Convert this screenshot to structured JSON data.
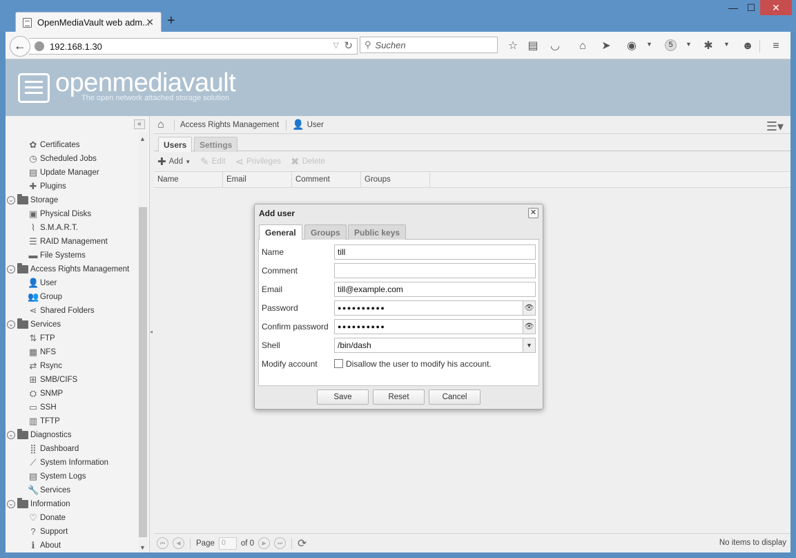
{
  "browser": {
    "tab_title": "OpenMediaVault web adm...",
    "tab_close": "✕",
    "new_tab": "+",
    "win_min": "—",
    "win_max": "☐",
    "win_close": "✕",
    "url": "192.168.1.30",
    "search_placeholder": "Suchen",
    "badge": "5"
  },
  "omv": {
    "logo_text": "openmediavault",
    "logo_sub": "The open network attached storage solution"
  },
  "sidebar": {
    "items": [
      {
        "type": "leaf",
        "label": "Certificates",
        "icon": "certificate-icon",
        "glyph": "✿"
      },
      {
        "type": "leaf",
        "label": "Scheduled Jobs",
        "icon": "clock-icon",
        "glyph": "◷"
      },
      {
        "type": "leaf",
        "label": "Update Manager",
        "icon": "update-icon",
        "glyph": "▤"
      },
      {
        "type": "leaf",
        "label": "Plugins",
        "icon": "puzzle-icon",
        "glyph": "✚"
      },
      {
        "type": "group",
        "label": "Storage"
      },
      {
        "type": "leaf",
        "label": "Physical Disks",
        "icon": "disk-icon",
        "glyph": "▣"
      },
      {
        "type": "leaf",
        "label": "S.M.A.R.T.",
        "icon": "smart-icon",
        "glyph": "⌇"
      },
      {
        "type": "leaf",
        "label": "RAID Management",
        "icon": "raid-icon",
        "glyph": "☰"
      },
      {
        "type": "leaf",
        "label": "File Systems",
        "icon": "filesystem-icon",
        "glyph": "▬"
      },
      {
        "type": "group",
        "label": "Access Rights Management"
      },
      {
        "type": "leaf",
        "label": "User",
        "icon": "user-icon",
        "glyph": "👤"
      },
      {
        "type": "leaf",
        "label": "Group",
        "icon": "group-icon",
        "glyph": "👥"
      },
      {
        "type": "leaf",
        "label": "Shared Folders",
        "icon": "share-icon",
        "glyph": "⋖"
      },
      {
        "type": "group",
        "label": "Services"
      },
      {
        "type": "leaf",
        "label": "FTP",
        "icon": "ftp-icon",
        "glyph": "⇅"
      },
      {
        "type": "leaf",
        "label": "NFS",
        "icon": "nfs-icon",
        "glyph": "▦"
      },
      {
        "type": "leaf",
        "label": "Rsync",
        "icon": "rsync-icon",
        "glyph": "⇄"
      },
      {
        "type": "leaf",
        "label": "SMB/CIFS",
        "icon": "windows-icon",
        "glyph": "⊞"
      },
      {
        "type": "leaf",
        "label": "SNMP",
        "icon": "snmp-icon",
        "glyph": "⛭"
      },
      {
        "type": "leaf",
        "label": "SSH",
        "icon": "terminal-icon",
        "glyph": "▭"
      },
      {
        "type": "leaf",
        "label": "TFTP",
        "icon": "tftp-icon",
        "glyph": "▥"
      },
      {
        "type": "group",
        "label": "Diagnostics"
      },
      {
        "type": "leaf",
        "label": "Dashboard",
        "icon": "dashboard-icon",
        "glyph": "⣿"
      },
      {
        "type": "leaf",
        "label": "System Information",
        "icon": "chart-icon",
        "glyph": "⟋"
      },
      {
        "type": "leaf",
        "label": "System Logs",
        "icon": "log-icon",
        "glyph": "▤"
      },
      {
        "type": "leaf",
        "label": "Services",
        "icon": "wrench-icon",
        "glyph": "🔧"
      },
      {
        "type": "group",
        "label": "Information"
      },
      {
        "type": "leaf",
        "label": "Donate",
        "icon": "heart-icon",
        "glyph": "♡"
      },
      {
        "type": "leaf",
        "label": "Support",
        "icon": "question-icon",
        "glyph": "?"
      },
      {
        "type": "leaf",
        "label": "About",
        "icon": "info-icon",
        "glyph": "ℹ"
      }
    ]
  },
  "breadcrumb": {
    "section": "Access Rights Management",
    "page": "User"
  },
  "panel_tabs": [
    "Users",
    "Settings"
  ],
  "toolbar": {
    "add": "Add",
    "edit": "Edit",
    "privileges": "Privileges",
    "delete": "Delete"
  },
  "grid": {
    "columns": [
      "Name",
      "Email",
      "Comment",
      "Groups"
    ]
  },
  "pager": {
    "page_label": "Page",
    "page_value": "0",
    "of_label": "of 0",
    "status": "No items to display"
  },
  "dialog": {
    "title": "Add user",
    "tabs": [
      "General",
      "Groups",
      "Public keys"
    ],
    "fields": {
      "name_label": "Name",
      "name_value": "till",
      "comment_label": "Comment",
      "comment_value": "",
      "email_label": "Email",
      "email_value": "till@example.com",
      "password_label": "Password",
      "password_mask": "●●●●●●●●●●",
      "confirm_label": "Confirm password",
      "confirm_mask": "●●●●●●●●●●",
      "shell_label": "Shell",
      "shell_value": "/bin/dash",
      "modify_label": "Modify account",
      "modify_checkbox_label": "Disallow the user to modify his account."
    },
    "buttons": {
      "save": "Save",
      "reset": "Reset",
      "cancel": "Cancel"
    }
  }
}
